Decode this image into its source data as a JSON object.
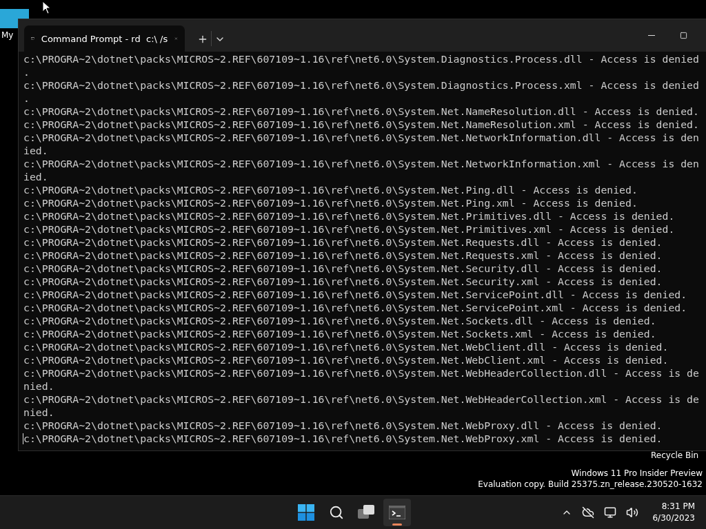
{
  "desktop": {
    "icons": [
      {
        "label": "My"
      },
      {
        "label": "Recycle Bin"
      }
    ],
    "watermark": [
      "Windows 11 Pro Insider Preview",
      "Evaluation copy. Build 25375.zn_release.230520-1632"
    ]
  },
  "terminal": {
    "tab_title": "Command Prompt - rd  c:\\ /s",
    "tab_selected": true,
    "lines": [
      "c:\\PROGRA~2\\dotnet\\packs\\MICROS~2.REF\\607109~1.16\\ref\\net6.0\\System.Diagnostics.Process.dll - Access is denied",
      ".",
      "c:\\PROGRA~2\\dotnet\\packs\\MICROS~2.REF\\607109~1.16\\ref\\net6.0\\System.Diagnostics.Process.xml - Access is denied",
      ".",
      "c:\\PROGRA~2\\dotnet\\packs\\MICROS~2.REF\\607109~1.16\\ref\\net6.0\\System.Net.NameResolution.dll - Access is denied.",
      "c:\\PROGRA~2\\dotnet\\packs\\MICROS~2.REF\\607109~1.16\\ref\\net6.0\\System.Net.NameResolution.xml - Access is denied.",
      "c:\\PROGRA~2\\dotnet\\packs\\MICROS~2.REF\\607109~1.16\\ref\\net6.0\\System.Net.NetworkInformation.dll - Access is den",
      "ied.",
      "c:\\PROGRA~2\\dotnet\\packs\\MICROS~2.REF\\607109~1.16\\ref\\net6.0\\System.Net.NetworkInformation.xml - Access is den",
      "ied.",
      "c:\\PROGRA~2\\dotnet\\packs\\MICROS~2.REF\\607109~1.16\\ref\\net6.0\\System.Net.Ping.dll - Access is denied.",
      "c:\\PROGRA~2\\dotnet\\packs\\MICROS~2.REF\\607109~1.16\\ref\\net6.0\\System.Net.Ping.xml - Access is denied.",
      "c:\\PROGRA~2\\dotnet\\packs\\MICROS~2.REF\\607109~1.16\\ref\\net6.0\\System.Net.Primitives.dll - Access is denied.",
      "c:\\PROGRA~2\\dotnet\\packs\\MICROS~2.REF\\607109~1.16\\ref\\net6.0\\System.Net.Primitives.xml - Access is denied.",
      "c:\\PROGRA~2\\dotnet\\packs\\MICROS~2.REF\\607109~1.16\\ref\\net6.0\\System.Net.Requests.dll - Access is denied.",
      "c:\\PROGRA~2\\dotnet\\packs\\MICROS~2.REF\\607109~1.16\\ref\\net6.0\\System.Net.Requests.xml - Access is denied.",
      "c:\\PROGRA~2\\dotnet\\packs\\MICROS~2.REF\\607109~1.16\\ref\\net6.0\\System.Net.Security.dll - Access is denied.",
      "c:\\PROGRA~2\\dotnet\\packs\\MICROS~2.REF\\607109~1.16\\ref\\net6.0\\System.Net.Security.xml - Access is denied.",
      "c:\\PROGRA~2\\dotnet\\packs\\MICROS~2.REF\\607109~1.16\\ref\\net6.0\\System.Net.ServicePoint.dll - Access is denied.",
      "c:\\PROGRA~2\\dotnet\\packs\\MICROS~2.REF\\607109~1.16\\ref\\net6.0\\System.Net.ServicePoint.xml - Access is denied.",
      "c:\\PROGRA~2\\dotnet\\packs\\MICROS~2.REF\\607109~1.16\\ref\\net6.0\\System.Net.Sockets.dll - Access is denied.",
      "c:\\PROGRA~2\\dotnet\\packs\\MICROS~2.REF\\607109~1.16\\ref\\net6.0\\System.Net.Sockets.xml - Access is denied.",
      "c:\\PROGRA~2\\dotnet\\packs\\MICROS~2.REF\\607109~1.16\\ref\\net6.0\\System.Net.WebClient.dll - Access is denied.",
      "c:\\PROGRA~2\\dotnet\\packs\\MICROS~2.REF\\607109~1.16\\ref\\net6.0\\System.Net.WebClient.xml - Access is denied.",
      "c:\\PROGRA~2\\dotnet\\packs\\MICROS~2.REF\\607109~1.16\\ref\\net6.0\\System.Net.WebHeaderCollection.dll - Access is de",
      "nied.",
      "c:\\PROGRA~2\\dotnet\\packs\\MICROS~2.REF\\607109~1.16\\ref\\net6.0\\System.Net.WebHeaderCollection.xml - Access is de",
      "nied.",
      "c:\\PROGRA~2\\dotnet\\packs\\MICROS~2.REF\\607109~1.16\\ref\\net6.0\\System.Net.WebProxy.dll - Access is denied.",
      "c:\\PROGRA~2\\dotnet\\packs\\MICROS~2.REF\\607109~1.16\\ref\\net6.0\\System.Net.WebProxy.xml - Access is denied."
    ]
  },
  "taskbar": {
    "apps": [
      {
        "kind": "start",
        "selected": false
      },
      {
        "kind": "search",
        "selected": false
      },
      {
        "kind": "taskview",
        "selected": false
      },
      {
        "kind": "terminal",
        "selected": true
      }
    ],
    "time": "8:31 PM",
    "date": "6/30/2023"
  }
}
